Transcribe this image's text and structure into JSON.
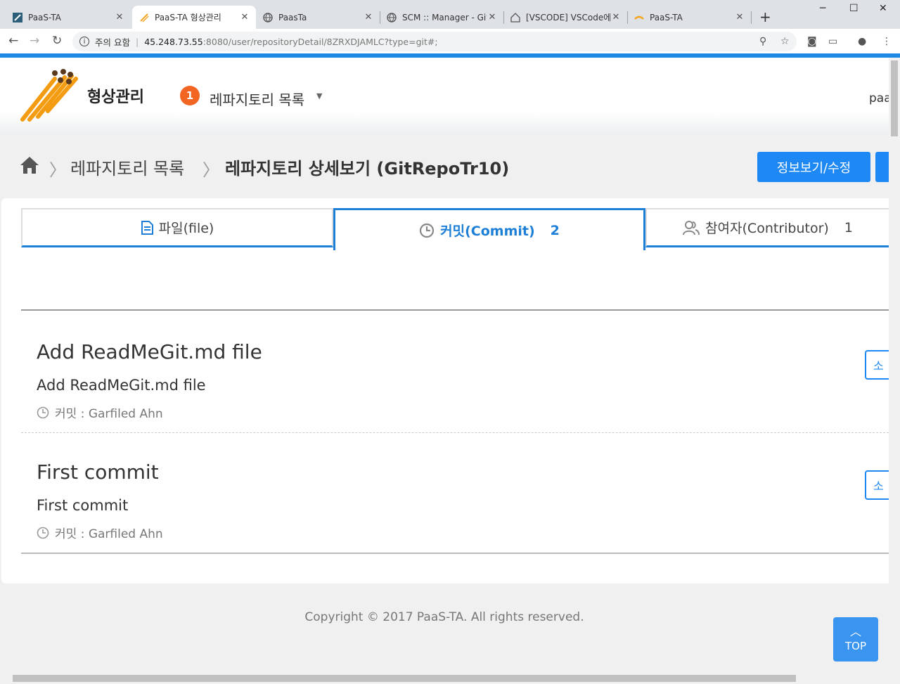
{
  "browser": {
    "tabs": [
      {
        "title": "PaaS-TA",
        "close": "✕"
      },
      {
        "title": "PaaS-TA 형상관리",
        "close": "✕"
      },
      {
        "title": "PaasTa",
        "close": "✕"
      },
      {
        "title": "SCM :: Manager - Git",
        "close": "✕"
      },
      {
        "title": "[VSCODE] VSCode에 G",
        "close": "✕"
      },
      {
        "title": "PaaS-TA",
        "close": "✕"
      }
    ],
    "new_tab": "+",
    "url_warning": "주의 요함",
    "url_host": "45.248.73.55",
    "url_path": ":8080/user/repositoryDetail/8ZRXDJAMLC?type=git#;"
  },
  "header": {
    "app_name": "형상관리",
    "step_badge": "1",
    "repo_menu": "레파지토리 목록",
    "user": "paa"
  },
  "breadcrumb": {
    "item1": "레파지토리 목록",
    "item2": "레파지토리 상세보기 (GitRepoTr10)",
    "info_button": "정보보기/수정"
  },
  "tabs": {
    "file": {
      "label": "파일(file)"
    },
    "commit": {
      "label": "커밋(Commit)",
      "count": "2"
    },
    "contributor": {
      "label": "참여자(Contributor)",
      "count": "1"
    }
  },
  "commits": [
    {
      "title": "Add ReadMeGit.md file",
      "message": "Add ReadMeGit.md file",
      "meta": "커밋 : Garfiled Ahn",
      "side": "소"
    },
    {
      "title": "First commit",
      "message": "First commit",
      "meta": "커밋 : Garfiled Ahn",
      "side": "소"
    }
  ],
  "footer": {
    "copyright": "Copyright © 2017 PaaS-TA. All rights reserved."
  },
  "top_button": {
    "label": "TOP"
  },
  "colors": {
    "accent": "#1e7fd6",
    "button": "#1e88f5",
    "badge": "#f26522",
    "top": "#3a95f0"
  }
}
